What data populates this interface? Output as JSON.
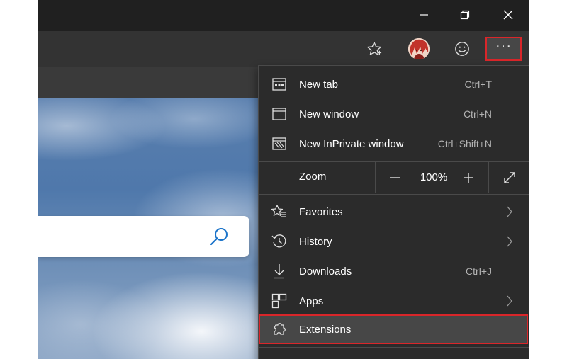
{
  "window": {
    "controls": {
      "minimize_icon": "minimize-icon",
      "restore_icon": "restore-icon",
      "close_icon": "close-icon"
    }
  },
  "toolbar": {
    "favorite_icon": "star-icon",
    "profile_icon": "avatar",
    "feedback_icon": "smiley-icon",
    "more_label": "···",
    "highlight_color": "#d9262a"
  },
  "menu": {
    "items": [
      {
        "label": "New tab",
        "shortcut": "Ctrl+T",
        "icon": "new-tab-icon"
      },
      {
        "label": "New window",
        "shortcut": "Ctrl+N",
        "icon": "new-window-icon"
      },
      {
        "label": "New InPrivate window",
        "shortcut": "Ctrl+Shift+N",
        "icon": "inprivate-icon"
      }
    ],
    "zoom": {
      "label": "Zoom",
      "value": "100%",
      "minus": "−",
      "plus": "+"
    },
    "items2": [
      {
        "label": "Favorites",
        "icon": "favorites-icon"
      },
      {
        "label": "History",
        "icon": "history-icon"
      },
      {
        "label": "Downloads",
        "shortcut": "Ctrl+J",
        "icon": "download-icon"
      },
      {
        "label": "Apps",
        "icon": "apps-icon"
      },
      {
        "label": "Extensions",
        "icon": "extensions-icon"
      }
    ]
  },
  "colors": {
    "menu_bg": "#2b2b2b",
    "titlebar_bg": "#202020",
    "toolbar_bg": "#333333",
    "highlight_border": "#d9262a"
  }
}
